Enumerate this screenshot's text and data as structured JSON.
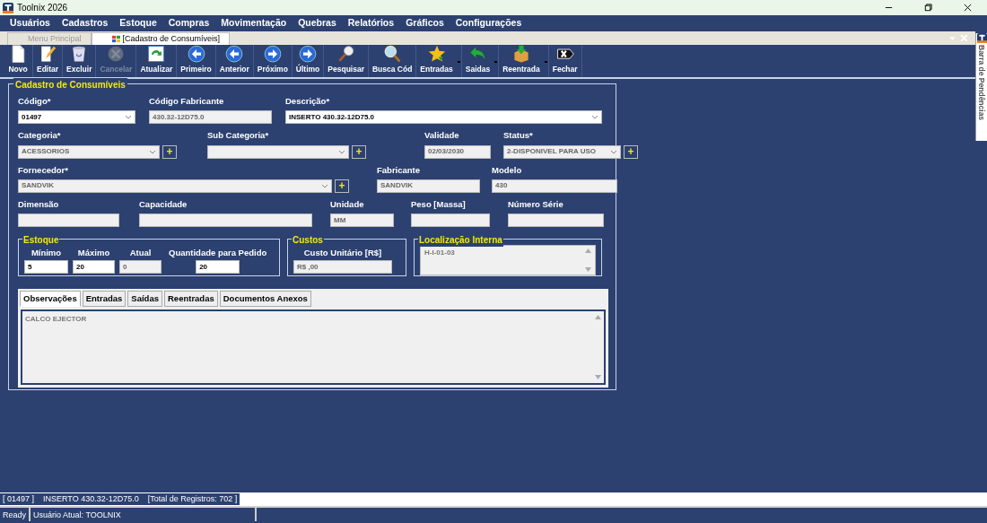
{
  "window": {
    "title": "Toolnix 2026"
  },
  "menu": [
    "Usuários",
    "Cadastros",
    "Estoque",
    "Compras",
    "Movimentação",
    "Quebras",
    "Relatórios",
    "Gráficos",
    "Configurações"
  ],
  "doc_tabs": [
    {
      "label": "Menu Principal",
      "selected": false
    },
    {
      "label": "[Cadastro de Consumíveis]",
      "selected": true
    }
  ],
  "toolbar": [
    {
      "label": "Novo",
      "kind": "new",
      "disabled": false,
      "has_menu": false
    },
    {
      "label": "Editar",
      "kind": "edit",
      "disabled": false,
      "has_menu": false
    },
    {
      "label": "Excluir",
      "kind": "trash",
      "disabled": false,
      "has_menu": false
    },
    {
      "label": "Cancelar",
      "kind": "cancel",
      "disabled": true,
      "has_menu": false
    },
    {
      "label": "Atualizar",
      "kind": "refresh",
      "disabled": false,
      "has_menu": false
    },
    {
      "label": "Primeiro",
      "kind": "left",
      "disabled": false,
      "has_menu": false
    },
    {
      "label": "Anterior",
      "kind": "left",
      "disabled": false,
      "has_menu": false
    },
    {
      "label": "Próximo",
      "kind": "right",
      "disabled": false,
      "has_menu": false
    },
    {
      "label": "Último",
      "kind": "right",
      "disabled": false,
      "has_menu": false
    },
    {
      "label": "Pesquisar",
      "kind": "probe",
      "disabled": false,
      "has_menu": false
    },
    {
      "label": "Busca Cód",
      "kind": "magnifier",
      "disabled": false,
      "has_menu": false
    },
    {
      "label": "Entradas",
      "kind": "star",
      "disabled": false,
      "has_menu": true
    },
    {
      "label": "Saidas",
      "kind": "return",
      "disabled": false,
      "has_menu": true
    },
    {
      "label": "Reentrada",
      "kind": "box",
      "disabled": false,
      "has_menu": true
    },
    {
      "label": "Fechar",
      "kind": "close",
      "disabled": false,
      "has_menu": false
    }
  ],
  "side_panel": {
    "label": "Barra de Pendências"
  },
  "form": {
    "title": "Cadastro de Consumíveis",
    "rows": [
      {
        "fields": [
          {
            "label": "Código*",
            "value": "01497",
            "kind": "select",
            "disabled": false
          },
          {
            "label": "Código Fabricante",
            "value": "430.32-12D75.0",
            "kind": "text",
            "disabled": true
          },
          {
            "label": "Descrição*",
            "value": "INSERTO 430.32-12D75.0",
            "kind": "select",
            "disabled": false
          }
        ]
      },
      {
        "fields": [
          {
            "label": "Categoria*",
            "value": "ACESSORIOS",
            "kind": "select",
            "disabled": true,
            "button": "+"
          },
          {
            "label": "Sub Categoria*",
            "kind": "select",
            "disabled": true,
            "button": "+"
          },
          {
            "label": "Validade",
            "value": "02/03/2030",
            "kind": "text",
            "disabled": true
          },
          {
            "label": "Status*",
            "value": "2-DISPONIVEL PARA USO",
            "kind": "select",
            "disabled": true,
            "button": "+"
          }
        ]
      },
      {
        "fields": [
          {
            "label": "Fornecedor*",
            "value": "SANDVIK",
            "kind": "select",
            "disabled": true,
            "button": "+"
          },
          {
            "label": "Fabricante",
            "value": "SANDVIK",
            "kind": "text",
            "disabled": true
          },
          {
            "label": "Modelo",
            "value": "430",
            "kind": "text",
            "disabled": true
          }
        ]
      },
      {
        "fields": [
          {
            "label": "Dimensão",
            "kind": "text",
            "disabled": true
          },
          {
            "label": "Capacidade",
            "kind": "text",
            "disabled": true
          },
          {
            "label": "Unidade",
            "value": "MM",
            "kind": "text",
            "disabled": true
          },
          {
            "label": "Peso [Massa]",
            "kind": "text",
            "disabled": true
          },
          {
            "label": "Número Série",
            "kind": "text",
            "disabled": true
          }
        ]
      }
    ],
    "groups": [
      {
        "title": "Estoque",
        "fields": [
          {
            "label": "Mínimo",
            "value": "5",
            "kind": "text",
            "disabled": false
          },
          {
            "label": "Máximo",
            "value": "20",
            "kind": "text",
            "disabled": false
          },
          {
            "label": "Atual",
            "value": "0",
            "kind": "text",
            "disabled": true
          },
          {
            "label": "Quantidade para Pedido",
            "value": "20",
            "kind": "text",
            "disabled": false
          }
        ]
      },
      {
        "title": "Custos",
        "fields": [
          {
            "label": "Custo Unitário [R$]",
            "value": "R$ ,00",
            "kind": "text",
            "disabled": true
          }
        ]
      },
      {
        "title": "Localização Interna",
        "fields": [
          {
            "value": "H-I-01-03",
            "kind": "memo",
            "disabled": true
          }
        ]
      }
    ],
    "tabs": [
      {
        "label": "Observações",
        "selected": true
      },
      {
        "label": "Entradas",
        "selected": false
      },
      {
        "label": "Saídas",
        "selected": false
      },
      {
        "label": "Reentradas",
        "selected": false
      },
      {
        "label": "Documentos Anexos",
        "selected": false
      }
    ],
    "notes": "CALCO EJECTOR"
  },
  "record_line": [
    "[ 01497 ]",
    "INSERTO 430.32-12D75.0",
    "[Total de Registros: 702 ]"
  ],
  "status_bar": [
    "Ready",
    "Usuário Atual: TOOLNIX"
  ]
}
